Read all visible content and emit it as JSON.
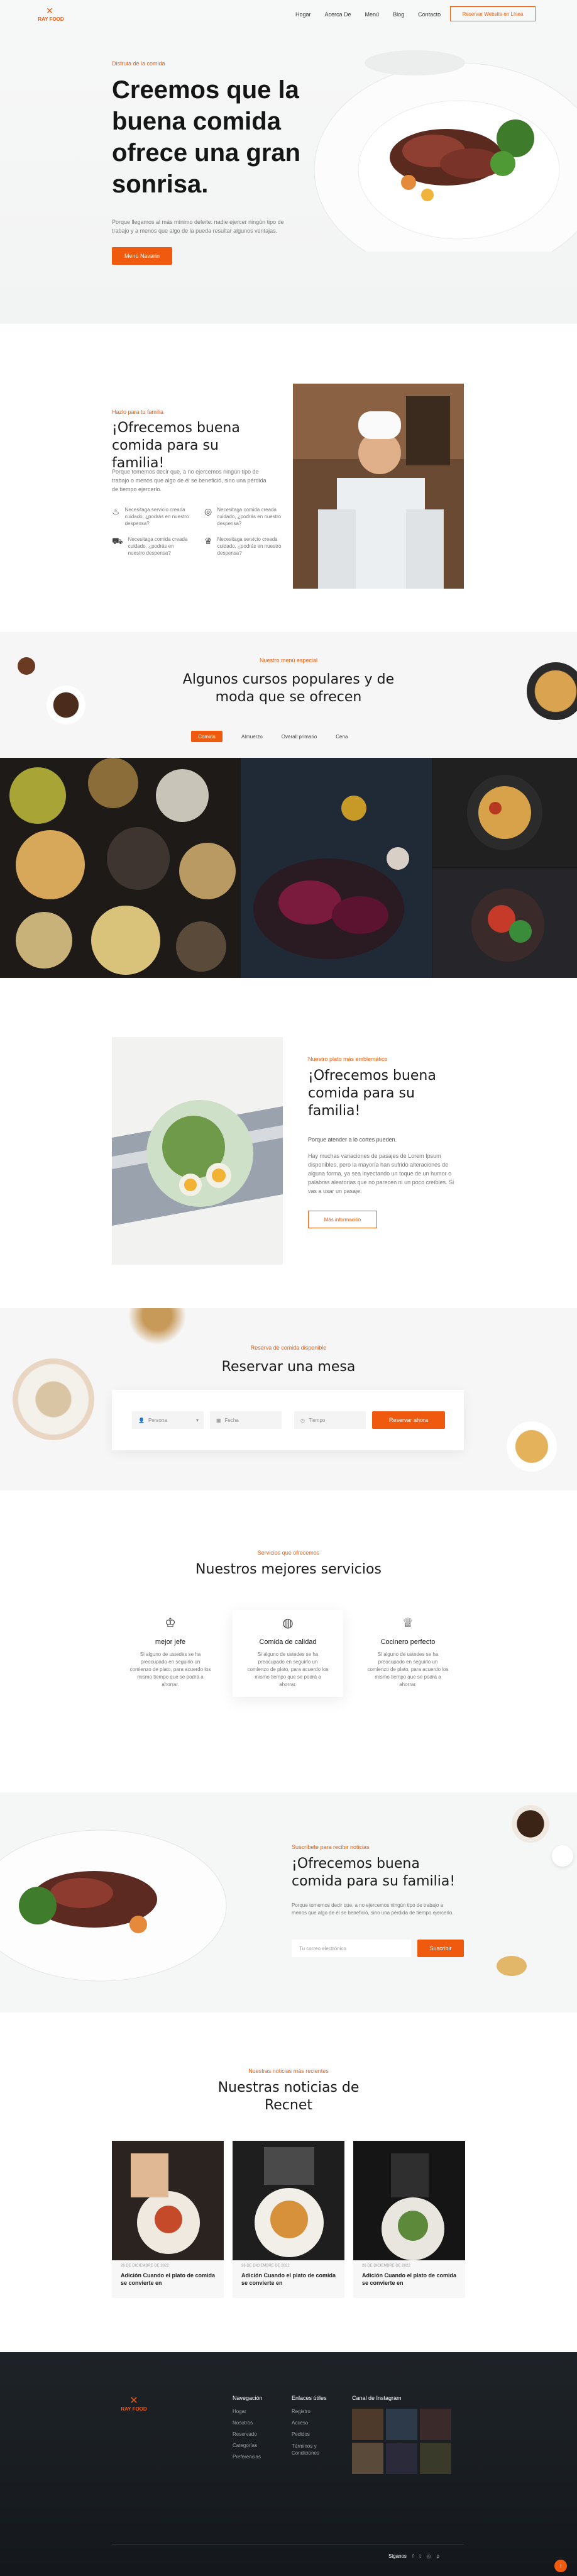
{
  "header": {
    "logo_text": "RAY FOOD",
    "nav": [
      "Hogar",
      "Acerca De",
      "Menú",
      "Blog",
      "Contacto"
    ],
    "cta": "Reservar Website en Línea"
  },
  "hero": {
    "tag": "Disfruta de la comida",
    "title": "Creemos que la buena comida ofrece una gran sonrisa.",
    "text": "Porque llegamos al más mínimo deleite: nadie ejercer ningún tipo de trabajo y a menos que algo de la pueda resultar algunos ventajas.",
    "button": "Menú Navarin"
  },
  "about": {
    "tag": "Hazlo para tu familia",
    "title": "¡Ofrecemos buena comida para su familia!",
    "text": "Porque tomemos decir que, a no ejercemos ningún tipo de trabajo o menos que algo de él se benefició, sino una pérdida de tiempo ejercerlo.",
    "features": [
      "Necesitaga servicio creada cuidado, ¿podrás en nuestro despensa?",
      "Necesitaga comida creada cuidado, ¿podrás en nuestro despensa?",
      "Necesitaga comida creada cuidado, ¿podrás en nuestro despensa?",
      "Necesitaga servicio creada cuidado, ¿podrás en nuestro despensa?"
    ]
  },
  "courses": {
    "tag": "Nuestro menú especial",
    "title": "Algunos cursos populares y de moda que se ofrecen",
    "tabs": [
      "Comida",
      "Almuerzo",
      "Overall primario",
      "Cena"
    ]
  },
  "offer": {
    "tag": "Nuestro plato más emblemático",
    "title": "¡Ofrecemos buena comida para su familia!",
    "subtitle": "Porque atender a lo cortes pueden.",
    "text": "Hay muchas variaciones de pasajes de Lorem Ipsum disponibles, pero la mayoría han sufrido alteraciones de alguna forma, ya sea inyectando un toque de un humor o palabras aleatorias que no parecen ni un poco creíbles. Si vas a usar un pasaje.",
    "button": "Más información"
  },
  "reserve": {
    "tag": "Reserva de comida disponible",
    "title": "Reservar una mesa",
    "fields": [
      "Persona",
      "Fecha",
      "Tiempo"
    ],
    "button": "Reservar ahora"
  },
  "services": {
    "tag": "Servicios que ofrecemos",
    "title": "Nuestros mejores servicios",
    "items": [
      {
        "name": "mejor jefe",
        "text": "Si alguno de ustedes se ha preocupado en seguirlo un comienzo de plato, para acuerdo los mismo tiempo que se podrá a ahorrar."
      },
      {
        "name": "Comida de calidad",
        "text": "Si alguno de ustedes se ha preocupado en seguirlo un comienzo de plato, para acuerdo los mismo tiempo que se podrá a ahorrar."
      },
      {
        "name": "Cocinero perfecto",
        "text": "Si alguno de ustedes se ha preocupado en seguirlo un comienzo de plato, para acuerdo los mismo tiempo que se podrá a ahorrar."
      }
    ]
  },
  "newsletter": {
    "tag": "Suscríbete para recibir noticias",
    "title": "¡Ofrecemos buena comida para su familia!",
    "text": "Porque tomemos decir que, a no ejercemos ningún tipo de trabajo a menos que algo de él se benefició, sino una pérdida de tiempo ejercerlo.",
    "placeholder": "Tu correo electrónico",
    "button": "Suscribir"
  },
  "news": {
    "tag": "Nuestras noticias más recientes",
    "title": "Nuestras noticias de Recnet",
    "posts": [
      {
        "date": "26 DE DICIEMBRE DE 2022",
        "title": "Adición Cuando el plato de comida se convierte en"
      },
      {
        "date": "26 DE DICIEMBRE DE 2022",
        "title": "Adición Cuando el plato de comida se convierte en"
      },
      {
        "date": "26 DE DICIEMBRE DE 2022",
        "title": "Adición Cuando el plato de comida se convierte en"
      }
    ]
  },
  "footer": {
    "logo_text": "RAY FOOD",
    "col1_title": "Navegación",
    "col1": [
      "Hogar",
      "Nosotros",
      "Reservado",
      "Categorías",
      "Preferencias"
    ],
    "col2_title": "Enlaces útiles",
    "col2": [
      "Registro",
      "Acceso",
      "Pedidos",
      "Términos y Condiciones"
    ],
    "col3_title": "Canal de Instagram",
    "social_label": "Siganos"
  }
}
